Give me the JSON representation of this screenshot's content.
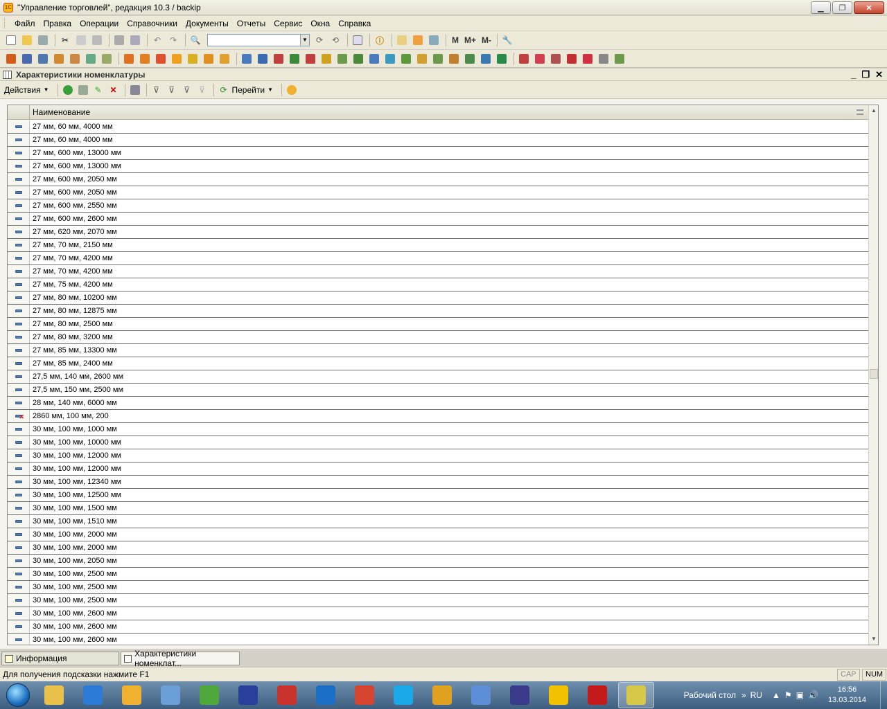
{
  "window": {
    "title": "\"Управление торговлей\", редакция 10.3 / backip"
  },
  "menu": [
    "Файл",
    "Правка",
    "Операции",
    "Справочники",
    "Документы",
    "Отчеты",
    "Сервис",
    "Окна",
    "Справка"
  ],
  "toolbar": {
    "m_label": "M",
    "mplus_label": "M+",
    "mminus_label": "M-"
  },
  "document": {
    "title": "Характеристики номенклатуры",
    "actions_label": "Действия",
    "goto_label": "Перейти"
  },
  "table": {
    "column_header": "Наименование",
    "rows": [
      {
        "name": "27 мм, 60 мм, 4000 мм",
        "deleted": false
      },
      {
        "name": "27 мм, 60 мм, 4000 мм",
        "deleted": false
      },
      {
        "name": "27 мм, 600 мм, 13000 мм",
        "deleted": false
      },
      {
        "name": "27 мм, 600 мм, 13000 мм",
        "deleted": false
      },
      {
        "name": "27 мм, 600 мм, 2050 мм",
        "deleted": false
      },
      {
        "name": "27 мм, 600 мм, 2050 мм",
        "deleted": false
      },
      {
        "name": "27 мм, 600 мм, 2550 мм",
        "deleted": false
      },
      {
        "name": "27 мм, 600 мм, 2600 мм",
        "deleted": false
      },
      {
        "name": "27 мм, 620 мм, 2070 мм",
        "deleted": false
      },
      {
        "name": "27 мм, 70 мм, 2150 мм",
        "deleted": false
      },
      {
        "name": "27 мм, 70 мм, 4200 мм",
        "deleted": false
      },
      {
        "name": "27 мм, 70 мм, 4200 мм",
        "deleted": false
      },
      {
        "name": "27 мм, 75 мм, 4200 мм",
        "deleted": false
      },
      {
        "name": "27 мм, 80 мм, 10200 мм",
        "deleted": false
      },
      {
        "name": "27 мм, 80 мм, 12875 мм",
        "deleted": false
      },
      {
        "name": "27 мм, 80 мм, 2500 мм",
        "deleted": false
      },
      {
        "name": "27 мм, 80 мм, 3200 мм",
        "deleted": false
      },
      {
        "name": "27 мм, 85 мм, 13300 мм",
        "deleted": false
      },
      {
        "name": "27 мм, 85 мм, 2400 мм",
        "deleted": false
      },
      {
        "name": "27,5 мм, 140 мм, 2600 мм",
        "deleted": false
      },
      {
        "name": "27,5 мм, 150 мм, 2500 мм",
        "deleted": false
      },
      {
        "name": "28 мм, 140 мм, 6000 мм",
        "deleted": false
      },
      {
        "name": "2860 мм, 100 мм, 200",
        "deleted": true
      },
      {
        "name": "30 мм, 100 мм, 1000 мм",
        "deleted": false
      },
      {
        "name": "30 мм, 100 мм, 10000 мм",
        "deleted": false
      },
      {
        "name": "30 мм, 100 мм, 12000 мм",
        "deleted": false
      },
      {
        "name": "30 мм, 100 мм, 12000 мм",
        "deleted": false
      },
      {
        "name": "30 мм, 100 мм, 12340 мм",
        "deleted": false
      },
      {
        "name": "30 мм, 100 мм, 12500 мм",
        "deleted": false
      },
      {
        "name": "30 мм, 100 мм, 1500 мм",
        "deleted": false
      },
      {
        "name": "30 мм, 100 мм, 1510 мм",
        "deleted": false
      },
      {
        "name": "30 мм, 100 мм, 2000 мм",
        "deleted": false
      },
      {
        "name": "30 мм, 100 мм, 2000 мм",
        "deleted": false
      },
      {
        "name": "30 мм, 100 мм, 2050 мм",
        "deleted": false
      },
      {
        "name": "30 мм, 100 мм, 2500 мм",
        "deleted": false
      },
      {
        "name": "30 мм, 100 мм, 2500 мм",
        "deleted": false
      },
      {
        "name": "30 мм, 100 мм, 2500 мм",
        "deleted": false
      },
      {
        "name": "30 мм, 100 мм, 2600 мм",
        "deleted": false
      },
      {
        "name": "30 мм, 100 мм, 2600 мм",
        "deleted": false
      },
      {
        "name": "30 мм, 100 мм, 2600 мм",
        "deleted": false
      }
    ]
  },
  "window_tabs": [
    {
      "label": "Информация",
      "active": false
    },
    {
      "label": "Характеристики номенклат...",
      "active": true
    }
  ],
  "status": {
    "hint": "Для получения подсказки нажмите F1",
    "cap": "CAP",
    "num": "NUM"
  },
  "taskbar": {
    "desktop_label": "Рабочий стол",
    "lang": "RU",
    "time": "16:56",
    "date": "13.03.2014",
    "apps": [
      {
        "name": "explorer-icon",
        "color": "#e8c04a",
        "active": false
      },
      {
        "name": "ie-icon",
        "color": "#2c7bd6",
        "active": false
      },
      {
        "name": "outlook-icon",
        "color": "#f0b030",
        "active": false
      },
      {
        "name": "file-manager-icon",
        "color": "#6a9fd8",
        "active": false
      },
      {
        "name": "utorrent-icon",
        "color": "#4fa83c",
        "active": false
      },
      {
        "name": "save-disk-icon",
        "color": "#2a3f9a",
        "active": false
      },
      {
        "name": "vnc-icon",
        "color": "#c8342c",
        "active": false
      },
      {
        "name": "teamviewer-icon",
        "color": "#1b6fc7",
        "active": false
      },
      {
        "name": "ccleaner-icon",
        "color": "#d6452f",
        "active": false
      },
      {
        "name": "skype-icon",
        "color": "#1aa8e8",
        "active": false
      },
      {
        "name": "chrome-icon",
        "color": "#e0a020",
        "active": false
      },
      {
        "name": "music-icon",
        "color": "#5c8fd8",
        "active": false
      },
      {
        "name": "editor-icon",
        "color": "#3a3a8a",
        "active": false
      },
      {
        "name": "1c-icon",
        "color": "#f2c200",
        "active": false
      },
      {
        "name": "pdf-icon",
        "color": "#c41a1a",
        "active": false
      },
      {
        "name": "draw-icon",
        "color": "#d8c84a",
        "active": true
      }
    ]
  }
}
